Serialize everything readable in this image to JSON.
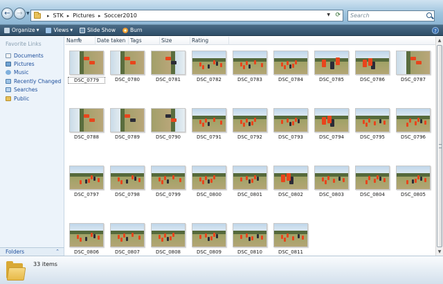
{
  "address": {
    "breadcrumb": [
      "STK",
      "Pictures",
      "Soccer2010"
    ],
    "search_placeholder": "Search"
  },
  "toolbar": {
    "organize": "Organize",
    "views": "Views",
    "slideshow": "Slide Show",
    "burn": "Burn"
  },
  "sidebar": {
    "title": "Favorite Links",
    "items": [
      {
        "label": "Documents",
        "icon": "documents-icon"
      },
      {
        "label": "Pictures",
        "icon": "pictures-icon"
      },
      {
        "label": "Music",
        "icon": "music-icon"
      },
      {
        "label": "Recently Changed",
        "icon": "recent-icon"
      },
      {
        "label": "Searches",
        "icon": "search-folder-icon"
      },
      {
        "label": "Public",
        "icon": "public-folder-icon"
      }
    ],
    "folders_label": "Folders"
  },
  "columns": [
    "Name",
    "Date taken",
    "Tags",
    "Size",
    "Rating"
  ],
  "files": [
    {
      "name": "DSC_0779",
      "kind": "rot",
      "selected": true
    },
    {
      "name": "DSC_0780",
      "kind": "rot"
    },
    {
      "name": "DSC_0781",
      "kind": "rot-flip"
    },
    {
      "name": "DSC_0782",
      "kind": "land"
    },
    {
      "name": "DSC_0783",
      "kind": "land"
    },
    {
      "name": "DSC_0784",
      "kind": "land"
    },
    {
      "name": "DSC_0785",
      "kind": "action"
    },
    {
      "name": "DSC_0786",
      "kind": "action"
    },
    {
      "name": "DSC_0787",
      "kind": "rot"
    },
    {
      "name": "DSC_0788",
      "kind": "rot"
    },
    {
      "name": "DSC_0789",
      "kind": "rot"
    },
    {
      "name": "DSC_0790",
      "kind": "rot-flip"
    },
    {
      "name": "DSC_0791",
      "kind": "land"
    },
    {
      "name": "DSC_0792",
      "kind": "land"
    },
    {
      "name": "DSC_0793",
      "kind": "land"
    },
    {
      "name": "DSC_0794",
      "kind": "action"
    },
    {
      "name": "DSC_0795",
      "kind": "land"
    },
    {
      "name": "DSC_0796",
      "kind": "land"
    },
    {
      "name": "DSC_0797",
      "kind": "land"
    },
    {
      "name": "DSC_0798",
      "kind": "land"
    },
    {
      "name": "DSC_0799",
      "kind": "land"
    },
    {
      "name": "DSC_0800",
      "kind": "land"
    },
    {
      "name": "DSC_0801",
      "kind": "land"
    },
    {
      "name": "DSC_0802",
      "kind": "action"
    },
    {
      "name": "DSC_0803",
      "kind": "land"
    },
    {
      "name": "DSC_0804",
      "kind": "land"
    },
    {
      "name": "DSC_0805",
      "kind": "land"
    },
    {
      "name": "DSC_0806",
      "kind": "land"
    },
    {
      "name": "DSC_0807",
      "kind": "land"
    },
    {
      "name": "DSC_0808",
      "kind": "land"
    },
    {
      "name": "DSC_0809",
      "kind": "land"
    },
    {
      "name": "DSC_0810",
      "kind": "land"
    },
    {
      "name": "DSC_0811",
      "kind": "land"
    }
  ],
  "status": {
    "count": "33 items"
  },
  "colors": {
    "address_bar": "#9fc4de",
    "toolbar": "#2f4e68",
    "sidebar": "#ecf3fa",
    "link": "#1c4e9c",
    "jersey": "#e8451c"
  }
}
